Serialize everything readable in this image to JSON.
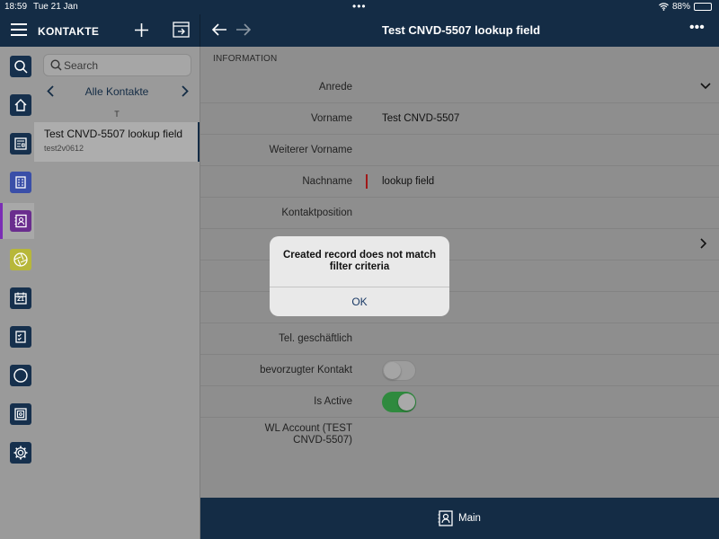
{
  "status": {
    "time": "18:59",
    "date": "Tue 21 Jan",
    "battery": "88%",
    "battery_level": 0.88
  },
  "header": {
    "list_title": "KONTAKTE",
    "record_title": "Test CNVD-5507 lookup field"
  },
  "rail": {
    "items": [
      {
        "icon": "search-icon",
        "color": "#16304d"
      },
      {
        "icon": "home-icon",
        "color": "#16304d"
      },
      {
        "icon": "news-icon",
        "color": "#16304d"
      },
      {
        "icon": "company-icon",
        "color": "#3a4fa8"
      },
      {
        "icon": "contact-icon",
        "color": "#6a2d8e",
        "active": true
      },
      {
        "icon": "aperture-icon",
        "color": "#b7b73a"
      },
      {
        "icon": "calendar-icon",
        "color": "#16304d",
        "text": "21"
      },
      {
        "icon": "task-icon",
        "color": "#16304d"
      },
      {
        "icon": "circle-icon",
        "color": "#16304d"
      },
      {
        "icon": "safe-icon",
        "color": "#16304d"
      },
      {
        "icon": "gear-icon",
        "color": "#16304d"
      }
    ]
  },
  "list": {
    "search_placeholder": "Search",
    "filter_label": "Alle Kontakte",
    "section_letter": "T",
    "items": [
      {
        "name": "Test CNVD-5507 lookup field",
        "sub": "test2v0612"
      }
    ]
  },
  "detail": {
    "section": "INFORMATION",
    "fields": [
      {
        "label": "Anrede",
        "value": ""
      },
      {
        "label": "Vorname",
        "value": "Test CNVD-5507"
      },
      {
        "label": "Weiterer Vorname",
        "value": ""
      },
      {
        "label": "Nachname",
        "value": "lookup field"
      },
      {
        "label": "Kontaktposition",
        "value": ""
      },
      {
        "label": "",
        "value": ""
      },
      {
        "label": "",
        "value": ""
      },
      {
        "label": "",
        "value": ""
      },
      {
        "label": "Tel. geschäftlich",
        "value": ""
      },
      {
        "label": "bevorzugter Kontakt",
        "value": "",
        "toggle": false
      },
      {
        "label": "Is Active",
        "value": "",
        "toggle": true
      }
    ],
    "wl_label_line1": "WL Account (TEST",
    "wl_label_line2": "CNVD-5507)"
  },
  "footer": {
    "tab_label": "Main"
  },
  "dialog": {
    "title_line1": "Created record does not match",
    "title_line2": "filter criteria",
    "ok_label": "OK"
  },
  "colors": {
    "header": "#142c45",
    "accent_active": "#7b2db5",
    "toggle_on": "#2f8a3e",
    "required": "#a01818"
  }
}
